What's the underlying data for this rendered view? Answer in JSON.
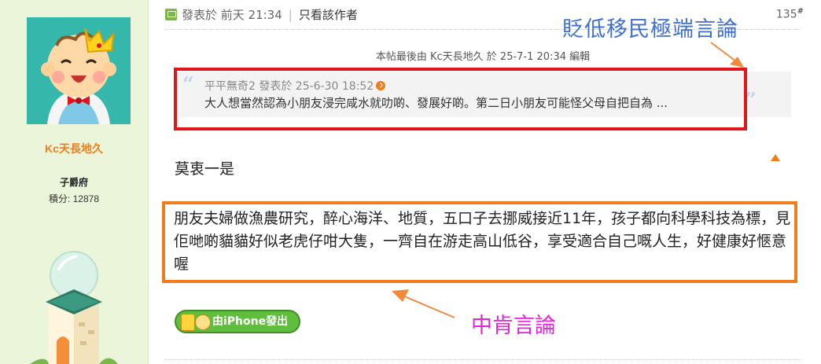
{
  "user": {
    "name": "Kc天長地久",
    "rank": "子爵府",
    "points": "積分: 12878"
  },
  "post": {
    "posted": "發表於 前天 21:34",
    "only_author": "只看該作者",
    "floor": "135",
    "floor_mark": "#",
    "edit_note": "本帖最後由 Kc天長地久 於 25-7-1 20:34 編輯",
    "short_reply": "莫衷一是",
    "body": "朋友夫婦做漁農研究，醉心海洋、地質，五口子去挪威接近11年，孩子都向科學科技為標，見佢哋啲貓貓好似老虎仔咁大隻，一齊自在游走高山低谷，享受適合自己嘅人生，好健康好愜意喔",
    "device_badge": "由iPhone發出"
  },
  "quote": {
    "author": "平平無奇2 發表於 25-6-30 18:52",
    "text": "大人想當然認為小朋友浸完咸水就叻啲、發展好啲。第二日小朋友可能怪父母自把自為 ..."
  },
  "annotations": {
    "top": "貶低移民極端言論",
    "bottom": "中肯言論",
    "top_color": "#3f6fd1",
    "bottom_color": "#e324d9",
    "red_box_color": "#e4141b",
    "orange_box_color": "#f07d1b"
  },
  "icons": {
    "post": "post-icon",
    "quote_jump": "jump-to-post-icon",
    "scroll_top": "scroll-top-icon",
    "device": "iphone-icon"
  }
}
